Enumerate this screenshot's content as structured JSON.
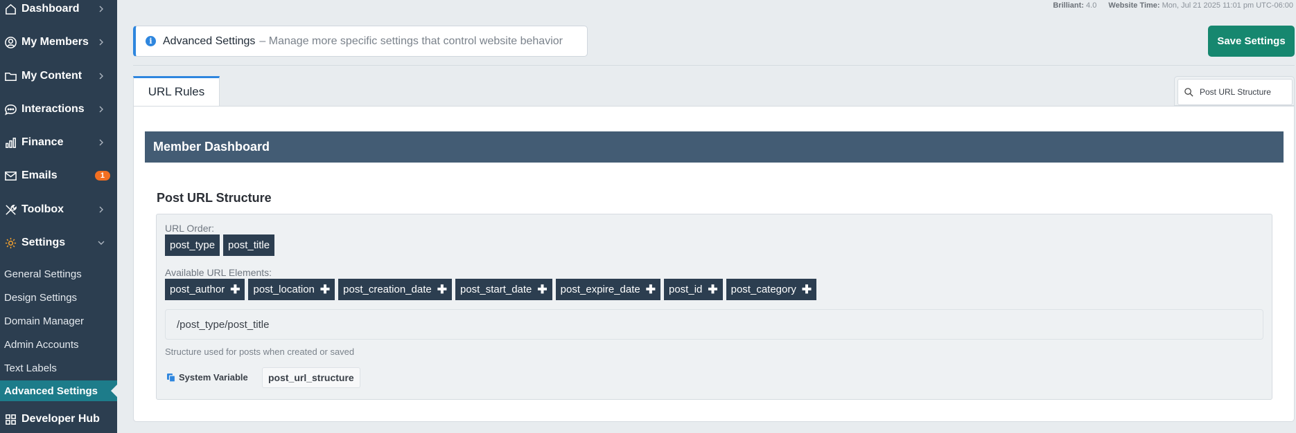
{
  "sidebar": {
    "items": [
      {
        "label": "Dashboard",
        "icon": "house-icon"
      },
      {
        "label": "My Members",
        "icon": "user-circle-icon"
      },
      {
        "label": "My Content",
        "icon": "folder-icon"
      },
      {
        "label": "Interactions",
        "icon": "chat-bubble-icon"
      },
      {
        "label": "Finance",
        "icon": "bar-chart-icon"
      },
      {
        "label": "Emails",
        "icon": "envelope-icon",
        "badge": "1"
      },
      {
        "label": "Toolbox",
        "icon": "tools-icon"
      },
      {
        "label": "Settings",
        "icon": "gear-icon"
      }
    ],
    "sub_items": [
      "General Settings",
      "Design Settings",
      "Domain Manager",
      "Admin Accounts",
      "Text Labels",
      "Advanced Settings"
    ],
    "bottom_item": {
      "label": "Developer Hub",
      "icon": "grid-icon"
    }
  },
  "meta": {
    "version_label": "Brilliant:",
    "version_value": "4.0",
    "time_label": "Website Time:",
    "time_value": "Mon, Jul 21 2025 11:01 pm UTC-06:00"
  },
  "banner": {
    "title": "Advanced Settings",
    "description": "– Manage more specific settings that control website behavior"
  },
  "save_button": "Save Settings",
  "tab": "URL Rules",
  "search": {
    "value": "Post URL Structure"
  },
  "section_header": "Member Dashboard",
  "post_url": {
    "title": "Post URL Structure",
    "order_label": "URL Order:",
    "order": [
      "post_type",
      "post_title"
    ],
    "available_label": "Available URL Elements:",
    "available": [
      "post_author",
      "post_location",
      "post_creation_date",
      "post_start_date",
      "post_expire_date",
      "post_id",
      "post_category"
    ],
    "preview": "/post_type/post_title",
    "help": "Structure used for posts when created or saved",
    "system_variable_label": "System Variable",
    "system_variable_value": "post_url_structure"
  },
  "colors": {
    "sidebar_bg": "#2c3e50",
    "active_sub": "#1d7c8a",
    "save_green": "#16876f",
    "header_bg": "#435c74",
    "accent_blue": "#2e86de",
    "badge_orange": "#f36f21"
  }
}
